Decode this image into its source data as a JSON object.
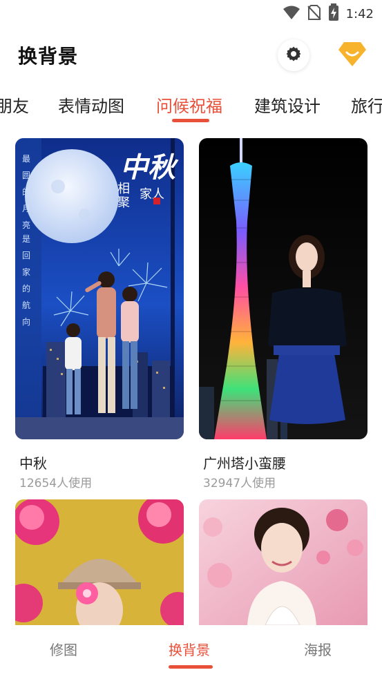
{
  "status_bar": {
    "time": "1:42",
    "icons": [
      "wifi-icon",
      "no-sim-icon",
      "battery-charging-icon"
    ]
  },
  "header": {
    "title": "换背景",
    "settings_icon": "gear-icon",
    "vip_icon": "diamond-icon",
    "accent_color": "#e8503a",
    "vip_color": "#f7b32b"
  },
  "tabs": [
    {
      "label": "朋友",
      "active": false
    },
    {
      "label": "表情动图",
      "active": false
    },
    {
      "label": "问候祝福",
      "active": true
    },
    {
      "label": "建筑设计",
      "active": false
    },
    {
      "label": "旅行",
      "active": false
    }
  ],
  "cards": [
    {
      "title": "中秋",
      "usage": "12654人使用",
      "poster_text": {
        "calligraphy": "中秋",
        "subtitle_left": "相聚",
        "subtitle_right": "家人",
        "vertical_a": "最圆的月亮",
        "vertical_b": "是回家的航向"
      }
    },
    {
      "title": "广州塔小蛮腰",
      "usage": "32947人使用"
    },
    {
      "title": "",
      "usage": ""
    },
    {
      "title": "",
      "usage": ""
    }
  ],
  "bottom_nav": [
    {
      "label": "修图",
      "active": false
    },
    {
      "label": "换背景",
      "active": true
    },
    {
      "label": "海报",
      "active": false
    }
  ]
}
